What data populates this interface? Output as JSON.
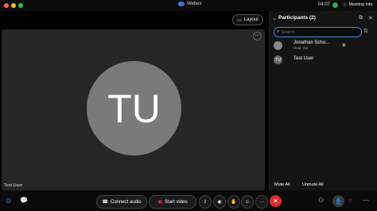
{
  "titlebar": {
    "app_name": "Webex",
    "time": "04:07",
    "meeting_info": "Meeting info"
  },
  "stage": {
    "layout_label": "Layout",
    "tile_initials": "TU",
    "tile_name": "Test User"
  },
  "panel": {
    "title": "Participants (2)",
    "search_placeholder": "Search",
    "participants": [
      {
        "name": "Jonathan Schu...",
        "role": "Host, me",
        "avatar": ""
      },
      {
        "name": "Test User",
        "role": "",
        "avatar": "TU"
      }
    ],
    "mute_all": "Mute All",
    "unmute_all": "Unmute All"
  },
  "controls": {
    "connect_audio": "Connect audio",
    "start_video": "Start video",
    "more_dots": "···"
  },
  "colors": {
    "accent": "#3d8ce3",
    "end_call": "#e02d34",
    "status": "#2fa84f"
  }
}
